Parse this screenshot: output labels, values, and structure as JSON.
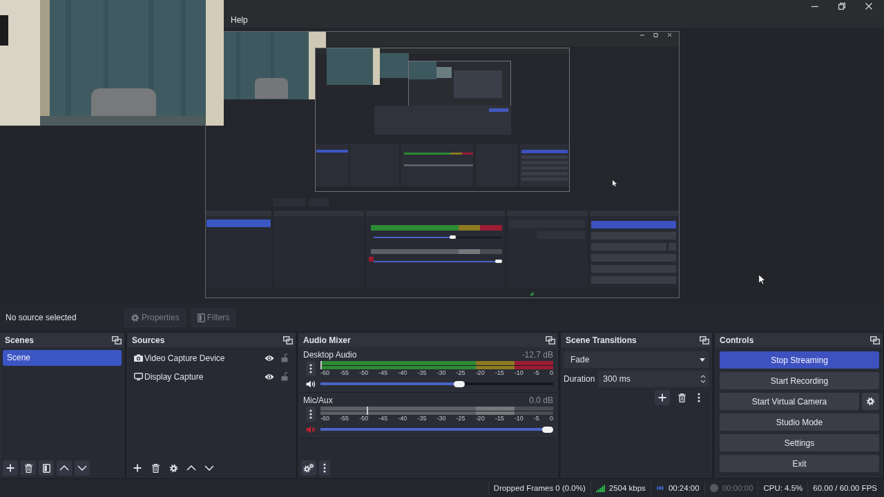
{
  "window": {
    "menu": [
      "Help"
    ]
  },
  "source_bar": {
    "status": "No source selected",
    "buttons": [
      {
        "label": "Properties",
        "disabled": true
      },
      {
        "label": "Filters",
        "disabled": true
      }
    ]
  },
  "scenes": {
    "title": "Scenes",
    "items": [
      {
        "label": "Scene",
        "selected": true
      }
    ]
  },
  "sources": {
    "title": "Sources",
    "items": [
      {
        "kind": "video",
        "label": "Video Capture Device",
        "visible": true,
        "locked": false
      },
      {
        "kind": "display",
        "label": "Display Capture",
        "visible": true,
        "locked": false
      }
    ]
  },
  "audio_mixer": {
    "title": "Audio Mixer",
    "channels": [
      {
        "name": "Desktop Audio",
        "reading": "-12.7 dB",
        "muted": false,
        "meter": {
          "level": 0
        },
        "scale": [
          "-60",
          "-55",
          "-50",
          "-45",
          "-40",
          "-35",
          "-30",
          "-25",
          "-20",
          "-15",
          "-10",
          "-5",
          "0"
        ],
        "volume": {
          "level": 0.6
        }
      },
      {
        "name": "Mic/Aux",
        "reading": "0.0 dB",
        "muted": true,
        "meter": {
          "level": 0.2
        },
        "scale": [
          "-60",
          "-55",
          "-50",
          "-45",
          "-40",
          "-35",
          "-30",
          "-25",
          "-20",
          "-15",
          "-10",
          "-5",
          "0"
        ],
        "volume": {
          "level": 1
        }
      }
    ]
  },
  "scene_transitions": {
    "title": "Scene Transitions",
    "transition": "Fade",
    "duration_label": "Duration",
    "duration": "300 ms"
  },
  "controls": {
    "title": "Controls",
    "buttons": [
      {
        "label": "Stop Streaming",
        "active": true,
        "has_settings": false
      },
      {
        "label": "Start Recording",
        "active": false,
        "has_settings": false
      },
      {
        "label": "Start Virtual Camera",
        "active": false,
        "has_settings": true
      },
      {
        "label": "Studio Mode",
        "active": false,
        "has_settings": false
      },
      {
        "label": "Settings",
        "active": false,
        "has_settings": false
      },
      {
        "label": "Exit",
        "active": false,
        "has_settings": false
      }
    ]
  },
  "status_bar": {
    "dropped_frames": "Dropped Frames 0 (0.0%)",
    "bitrate": "2504 kbps",
    "streaming": true,
    "stream_time": "00:24:00",
    "recording": false,
    "recording_time": "00:00:00",
    "cpu": "CPU: 4.5%",
    "fps": "60.00 / 60.00 FPS"
  }
}
